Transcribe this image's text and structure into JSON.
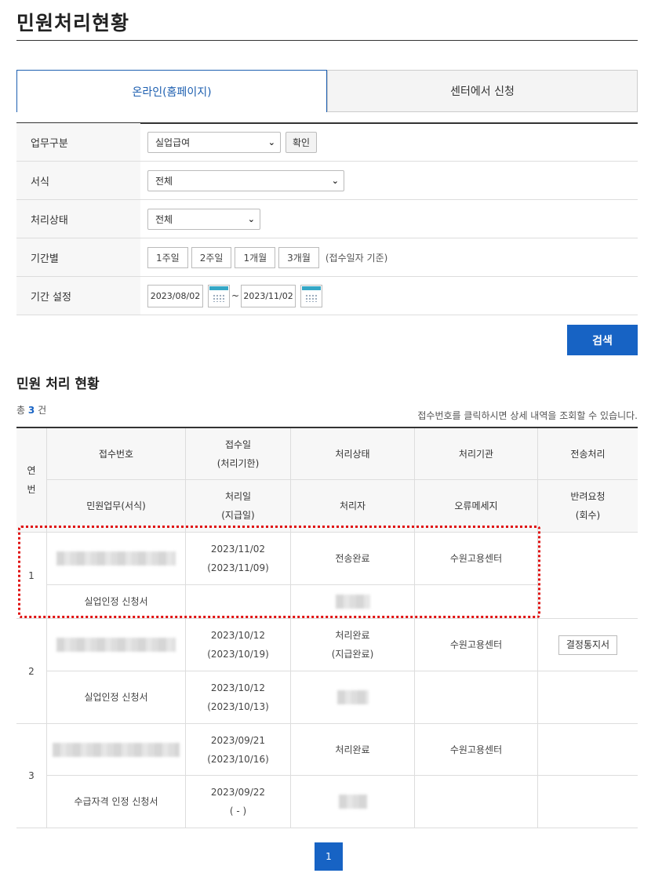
{
  "page": {
    "title": "민원처리현황"
  },
  "tabs": [
    {
      "label": "온라인(홈페이지)",
      "active": true
    },
    {
      "label": "센터에서 신청",
      "active": false
    }
  ],
  "form": {
    "task_type": {
      "label": "업무구분",
      "value": "실업급여",
      "confirm_label": "확인"
    },
    "document": {
      "label": "서식",
      "value": "전체"
    },
    "status": {
      "label": "처리상태",
      "value": "전체"
    },
    "period": {
      "label": "기간별",
      "options": [
        "1주일",
        "2주일",
        "1개월",
        "3개월"
      ],
      "hint": "(접수일자 기준)"
    },
    "date_range": {
      "label": "기간 설정",
      "start": "2023/08/02",
      "end": "2023/11/02",
      "separator": "~"
    },
    "search_label": "검색"
  },
  "results": {
    "title": "민원 처리 현황",
    "count_prefix": "총",
    "count": "3",
    "count_suffix": "건",
    "notice": "접수번호를 클릭하시면 상세 내역을 조회할 수 있습니다.",
    "headers": {
      "seq_line1": "연",
      "seq_line2": "번",
      "receipt_no": "접수번호",
      "receipt_date_1": "접수일",
      "receipt_date_2": "(처리기한)",
      "status": "처리상태",
      "agency": "처리기관",
      "transmission": "전송처리",
      "task_form": "민원업무(서식)",
      "proc_date_1": "처리일",
      "proc_date_2": "(지급일)",
      "handler": "처리자",
      "error_msg": "오류메세지",
      "return_1": "반려요청",
      "return_2": "(회수)"
    },
    "rows": [
      {
        "seq": "1",
        "receipt_date": "2023/11/02",
        "deadline": "(2023/11/09)",
        "status_1": "전송완료",
        "status_2": "",
        "agency": "수원고용센터",
        "action": "",
        "form": "실업인정 신청서",
        "proc_date": "",
        "pay_date": ""
      },
      {
        "seq": "2",
        "receipt_date": "2023/10/12",
        "deadline": "(2023/10/19)",
        "status_1": "처리완료",
        "status_2": "(지급완료)",
        "agency": "수원고용센터",
        "action": "결정통지서",
        "form": "실업인정 신청서",
        "proc_date": "2023/10/12",
        "pay_date": "(2023/10/13)"
      },
      {
        "seq": "3",
        "receipt_date": "2023/09/21",
        "deadline": "(2023/10/16)",
        "status_1": "처리완료",
        "status_2": "",
        "agency": "수원고용센터",
        "action": "",
        "form": "수급자격 인정 신청서",
        "proc_date": "2023/09/22",
        "pay_date": "( - )"
      }
    ]
  },
  "pagination": {
    "current": "1"
  },
  "colors": {
    "accent": "#1763c4",
    "highlight": "#e01010"
  }
}
